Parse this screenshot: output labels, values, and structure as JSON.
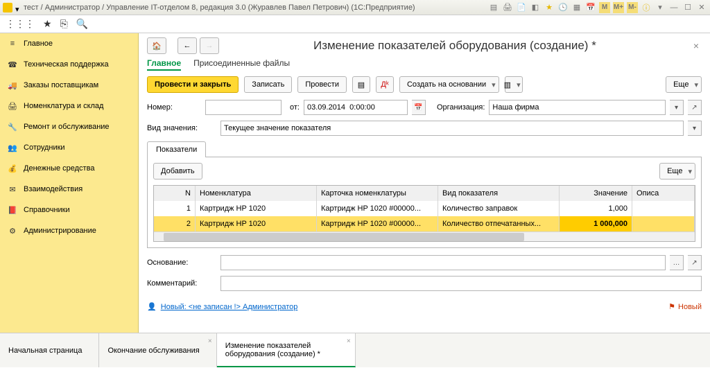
{
  "titlebar": "тест / Администратор / Управление IT-отделом 8, редакция 3.0 (Журавлев Павел Петрович)  (1С:Предприятие)",
  "mem": {
    "m": "M",
    "mp": "M+",
    "mm": "M-"
  },
  "sidebar": {
    "items": [
      {
        "label": "Главное",
        "icon": "≡"
      },
      {
        "label": "Техническая поддержка",
        "icon": "☎"
      },
      {
        "label": "Заказы поставщикам",
        "icon": "🚚"
      },
      {
        "label": "Номенклатура и склад",
        "icon": "🖨"
      },
      {
        "label": "Ремонт и обслуживание",
        "icon": "🔧"
      },
      {
        "label": "Сотрудники",
        "icon": "👥"
      },
      {
        "label": "Денежные средства",
        "icon": "💰"
      },
      {
        "label": "Взаимодействия",
        "icon": "✉"
      },
      {
        "label": "Справочники",
        "icon": "📕"
      },
      {
        "label": "Администрирование",
        "icon": "⚙"
      }
    ]
  },
  "page": {
    "title": "Изменение показателей оборудования (создание) *",
    "subtabs": {
      "main": "Главное",
      "files": "Присоединенные файлы"
    },
    "toolbar": {
      "post_close": "Провести и закрыть",
      "save": "Записать",
      "post": "Провести",
      "create_based": "Создать на основании",
      "more": "Еще"
    },
    "form": {
      "number_label": "Номер:",
      "number_value": "",
      "from_label": "от:",
      "date_value": "03.09.2014  0:00:00",
      "org_label": "Организация:",
      "org_value": "Наша фирма",
      "kind_label": "Вид значения:",
      "kind_value": "Текущее значение показателя",
      "basis_label": "Основание:",
      "basis_value": "",
      "comment_label": "Комментарий:",
      "comment_value": ""
    },
    "tabs": {
      "indicators": "Показатели"
    },
    "table": {
      "add": "Добавить",
      "more": "Еще",
      "columns": {
        "n": "N",
        "nom": "Номенклатура",
        "kart": "Карточка номенклатуры",
        "vid": "Вид показателя",
        "zn": "Значение",
        "op": "Описа"
      },
      "rows": [
        {
          "n": "1",
          "nom": "Картридж HP 1020",
          "kart": "Картридж HP 1020 #00000...",
          "vid": "Количество заправок",
          "zn": "1,000"
        },
        {
          "n": "2",
          "nom": "Картридж HP 1020",
          "kart": "Картридж HP 1020 #00000...",
          "vid": "Количество отпечатанных...",
          "zn": "1 000,000"
        }
      ]
    },
    "footer": {
      "link_text": "Новый: <не записан !> Администратор",
      "new_text": "Новый"
    }
  },
  "bottomtabs": [
    {
      "label": "Начальная страница",
      "closable": false
    },
    {
      "label": "Окончание обслуживания",
      "closable": true
    },
    {
      "label": "Изменение показателей оборудования (создание) *",
      "closable": true,
      "active": true
    }
  ]
}
